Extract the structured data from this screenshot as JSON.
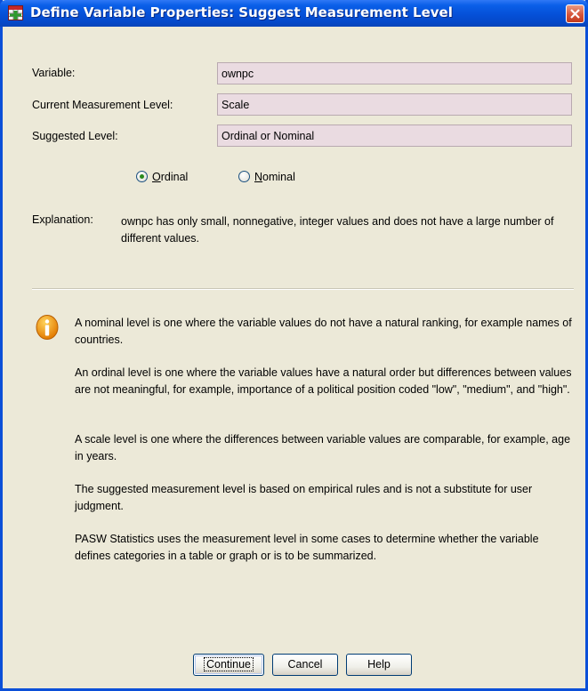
{
  "window": {
    "title": "Define Variable Properties: Suggest Measurement Level"
  },
  "fields": [
    {
      "label": "Variable:",
      "value": "ownpc"
    },
    {
      "label": "Current Measurement Level:",
      "value": "Scale"
    },
    {
      "label": "Suggested Level:",
      "value": "Ordinal or Nominal"
    }
  ],
  "radios": {
    "ordinal": {
      "mnemonic": "O",
      "rest": "rdinal",
      "checked": true
    },
    "nominal": {
      "mnemonic": "N",
      "rest": "ominal",
      "checked": false
    }
  },
  "explanation": {
    "label": "Explanation:",
    "text": "ownpc has only small, nonnegative, integer values and does not have a large number of different values."
  },
  "info": {
    "icon": "info-icon",
    "paragraphs": [
      "A nominal level is one where the variable values do not have a natural ranking, for example names of countries.",
      "An ordinal level is one where the variable values have a natural order but differences between values are not meaningful, for example, importance of a political position coded \"low\", \"medium\", and \"high\".",
      "A scale level is one where the differences between variable values are comparable, for example, age in years.",
      "The suggested measurement level is based on empirical rules and is not a substitute for user judgment.",
      "PASW Statistics uses the measurement level in some cases to determine whether the variable defines categories in a table or graph or is to be summarized."
    ]
  },
  "buttons": {
    "continue": "Continue",
    "cancel": "Cancel",
    "help": "Help"
  },
  "colors": {
    "titlebar": "#0550d8",
    "dialog_bg": "#ece9d8",
    "field_bg": "#eadbe1"
  }
}
